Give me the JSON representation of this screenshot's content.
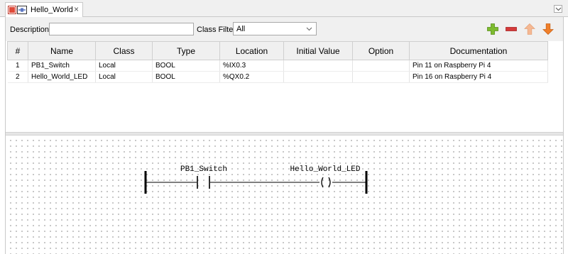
{
  "tab": {
    "title": "Hello_World",
    "close_glyph": "×",
    "icon": "pou-ladder-icon"
  },
  "filters": {
    "description_label": "Description:",
    "description_value": "",
    "class_filter_label": "Class Filter:",
    "class_filter_value": "All"
  },
  "toolbar": {
    "add_icon": "plus-icon",
    "remove_icon": "minus-icon",
    "move_up_icon": "arrow-up-icon",
    "move_down_icon": "arrow-down-icon",
    "colors": {
      "add": "#7dbb2f",
      "remove": "#d43a3a",
      "up": "#f5b893",
      "down": "#f07f2a"
    }
  },
  "table": {
    "columns": [
      "#",
      "Name",
      "Class",
      "Type",
      "Location",
      "Initial Value",
      "Option",
      "Documentation"
    ],
    "rows": [
      {
        "num": "1",
        "name": "PB1_Switch",
        "class": "Local",
        "type": "BOOL",
        "location": "%IX0.3",
        "initial": "",
        "option": "",
        "doc": "Pin 11 on Raspberry Pi 4"
      },
      {
        "num": "2",
        "name": "Hello_World_LED",
        "class": "Local",
        "type": "BOOL",
        "location": "%QX0.2",
        "initial": "",
        "option": "",
        "doc": "Pin 16 on Raspberry Pi 4"
      }
    ]
  },
  "ladder": {
    "contact_label": "PB1_Switch",
    "coil_label": "Hello_World_LED"
  }
}
